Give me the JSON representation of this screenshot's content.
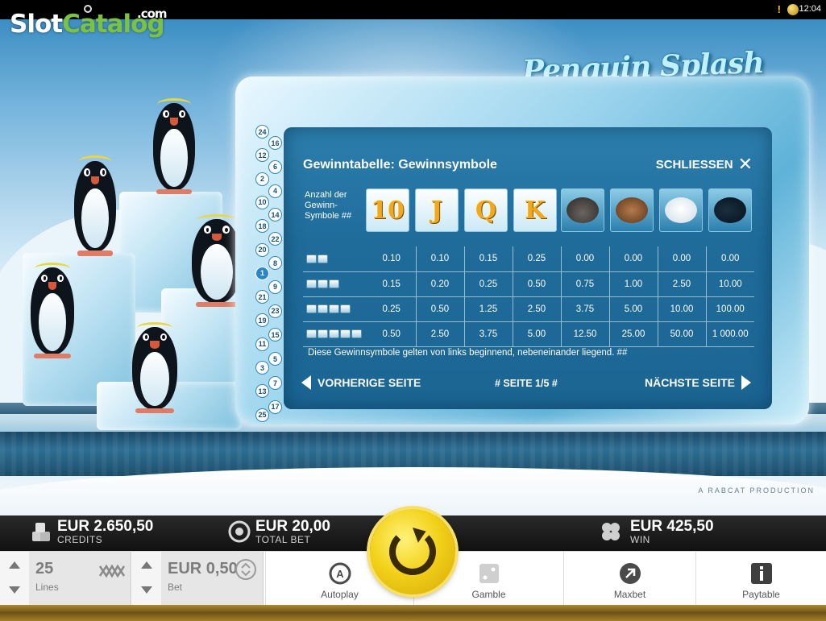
{
  "status_bar": {
    "time": "12:04"
  },
  "logo": {
    "slot": "Slot",
    "catalog": "Catalog",
    "com": ".com"
  },
  "game_title": "Penguin Splash",
  "paytable": {
    "title": "Gewinntabelle: Gewinnsymbole",
    "close_label": "SCHLIESSEN",
    "count_label": "Anzahl der Gewinn-Symbole ##",
    "symbols": [
      "10",
      "J",
      "Q",
      "K",
      "seal",
      "walrus",
      "polar-bear",
      "orca"
    ],
    "rows": [
      {
        "count": 2,
        "values": [
          "0.10",
          "0.10",
          "0.15",
          "0.25",
          "0.00",
          "0.00",
          "0.00",
          "0.00"
        ]
      },
      {
        "count": 3,
        "values": [
          "0.15",
          "0.20",
          "0.25",
          "0.50",
          "0.75",
          "1.00",
          "2.50",
          "10.00"
        ]
      },
      {
        "count": 4,
        "values": [
          "0.25",
          "0.50",
          "1.25",
          "2.50",
          "3.75",
          "5.00",
          "10.00",
          "100.00"
        ]
      },
      {
        "count": 5,
        "values": [
          "0.50",
          "2.50",
          "3.75",
          "5.00",
          "12.50",
          "25.00",
          "50.00",
          "1 000.00"
        ]
      }
    ],
    "note": "Diese Gewinnsymbole gelten von links beginnend, nebeneinander liegend. ##",
    "prev_label": "VORHERIGE SEITE",
    "next_label": "NÄCHSTE SEITE",
    "page_label": "# SEITE 1/5 #"
  },
  "line_markers": {
    "left": [
      "24",
      "12",
      "2",
      "10",
      "18",
      "20",
      "1",
      "21",
      "19",
      "11",
      "3",
      "13",
      "25"
    ],
    "right": [
      "16",
      "6",
      "4",
      "14",
      "22",
      "8",
      "9",
      "23",
      "15",
      "5",
      "7",
      "17"
    ],
    "active": "1"
  },
  "producer": "A RABCAT PRODUCTION",
  "info": {
    "credits_value": "EUR 2.650,50",
    "credits_label": "CREDITS",
    "total_bet_value": "EUR 20,00",
    "total_bet_label": "TOTAL BET",
    "win_value": "EUR 425,50",
    "win_label": "WIN"
  },
  "controls": {
    "lines_value": "25",
    "lines_label": "Lines",
    "bet_value": "EUR 0,50",
    "bet_label": "Bet",
    "autoplay": "Autoplay",
    "gamble": "Gamble",
    "maxbet": "Maxbet",
    "paytable": "Paytable"
  },
  "colors": {
    "accent_gold": "#f3d21a",
    "panel_blue": "#1f6c9b",
    "logo_green": "#7bc242"
  }
}
